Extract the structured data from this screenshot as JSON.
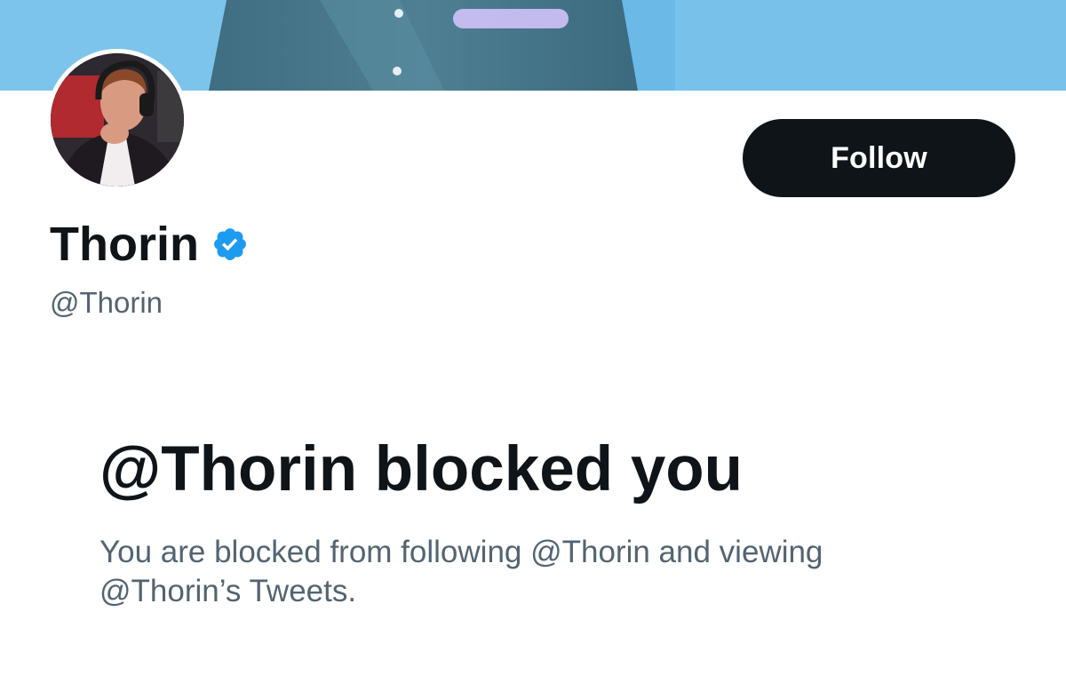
{
  "profile": {
    "display_name": "Thorin",
    "handle": "@Thorin",
    "verified": true,
    "follow_label": "Follow"
  },
  "blocked": {
    "title": "@Thorin blocked you",
    "description": "You are blocked from following @Thorin and viewing @Thorin’s Tweets."
  },
  "icons": {
    "verified": "verified-badge-icon"
  },
  "colors": {
    "primary_text": "#0f1419",
    "secondary_text": "#536471",
    "button_bg": "#0f1419",
    "button_text": "#ffffff",
    "verified_blue": "#1d9bf0",
    "banner_blue": "#5db0e3"
  }
}
